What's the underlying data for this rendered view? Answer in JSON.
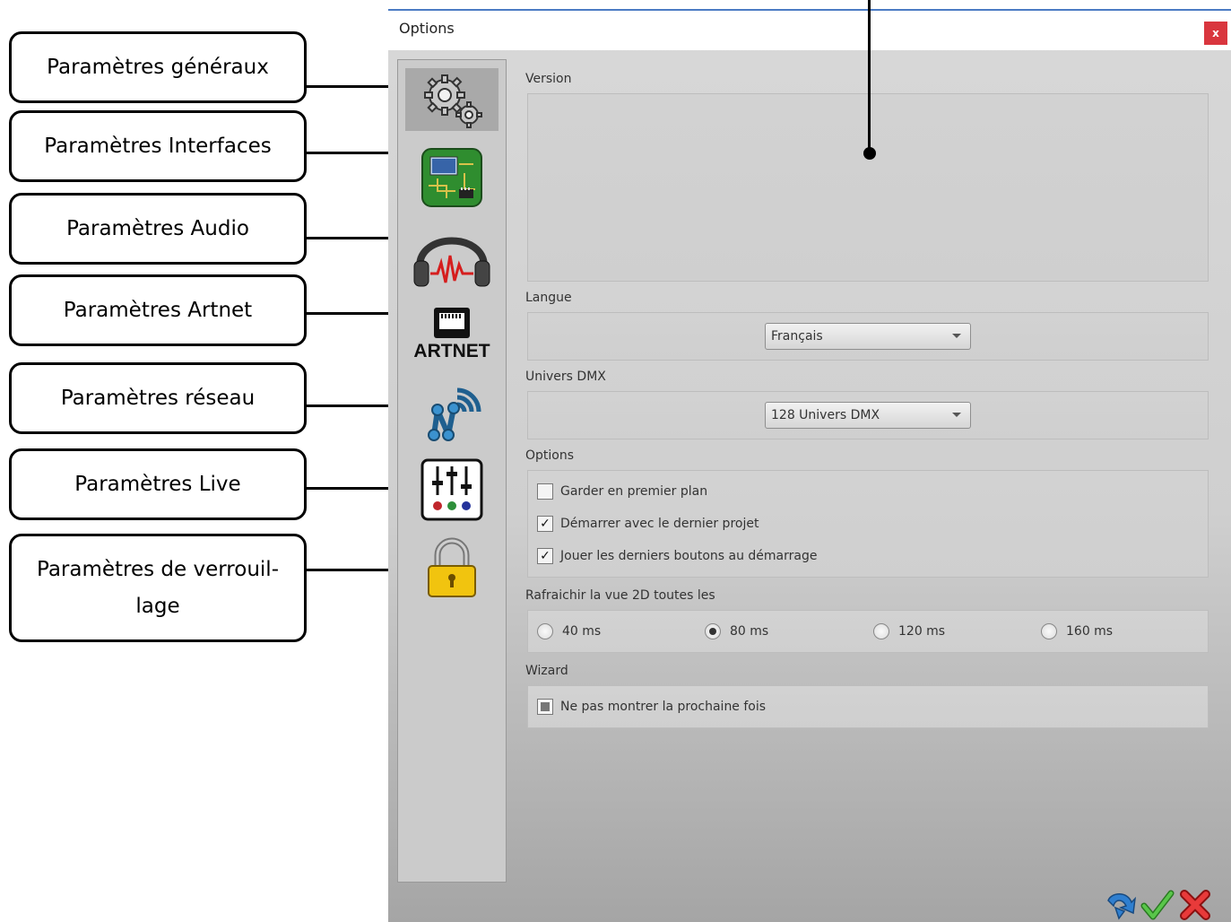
{
  "dialog": {
    "title": "Options",
    "close_label": "x"
  },
  "callouts": [
    {
      "label": "Paramètres généraux"
    },
    {
      "label": "Paramètres Interfaces"
    },
    {
      "label": "Paramètres Audio"
    },
    {
      "label": "Paramètres Artnet"
    },
    {
      "label": "Paramètres réseau"
    },
    {
      "label": "Paramètres Live"
    },
    {
      "label": "Paramètres de verrouil-lage"
    }
  ],
  "sidebar": {
    "items": [
      {
        "icon": "gears-icon",
        "selected": true
      },
      {
        "icon": "circuit-board-icon",
        "selected": false
      },
      {
        "icon": "headphones-icon",
        "selected": false
      },
      {
        "icon": "artnet-icon",
        "label": "ARTNET",
        "selected": false
      },
      {
        "icon": "network-icon",
        "selected": false
      },
      {
        "icon": "mixer-icon",
        "selected": false
      },
      {
        "icon": "lock-icon",
        "selected": false
      }
    ]
  },
  "sections": {
    "version": {
      "label": "Version"
    },
    "language": {
      "label": "Langue",
      "value": "Français"
    },
    "dmx": {
      "label": "Univers DMX",
      "value": "128 Univers DMX"
    },
    "options": {
      "label": "Options",
      "items": [
        {
          "label": "Garder en premier plan",
          "checked": false
        },
        {
          "label": "Démarrer avec le dernier projet",
          "checked": true
        },
        {
          "label": "Jouer les derniers boutons au démarrage",
          "checked": true
        }
      ]
    },
    "refresh": {
      "label": "Rafraichir la vue 2D toutes les",
      "options": [
        "40 ms",
        "80 ms",
        "120 ms",
        "160 ms"
      ],
      "selected": "80 ms"
    },
    "wizard": {
      "label": "Wizard",
      "checkbox_label": "Ne pas montrer la prochaine fois",
      "checked": "partial"
    }
  },
  "footer": {
    "icons": [
      "reset-icon",
      "ok-checkmark-icon",
      "cancel-x-icon"
    ]
  },
  "colors": {
    "accent": "#4b7bc4",
    "close": "#d9363e",
    "ok": "#3cab2e",
    "cancel": "#e02222"
  }
}
